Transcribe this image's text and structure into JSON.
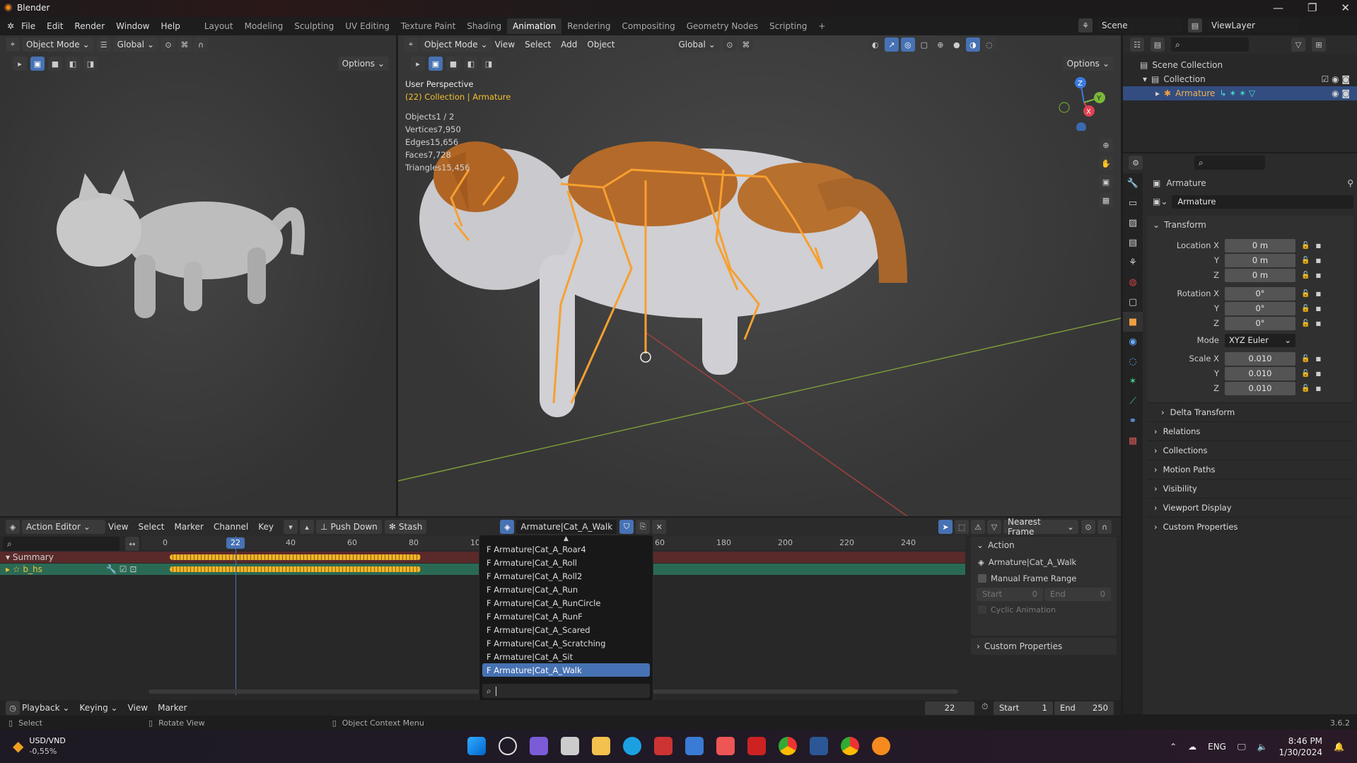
{
  "app": {
    "title": "Blender",
    "version": "3.6.2"
  },
  "menu": [
    "File",
    "Edit",
    "Render",
    "Window",
    "Help"
  ],
  "workspaces": [
    "Layout",
    "Modeling",
    "Sculpting",
    "UV Editing",
    "Texture Paint",
    "Shading",
    "Animation",
    "Rendering",
    "Compositing",
    "Geometry Nodes",
    "Scripting",
    "+"
  ],
  "active_workspace": "Animation",
  "scene": {
    "name": "Scene",
    "view_layer": "ViewLayer"
  },
  "left_view": {
    "mode": "Object Mode",
    "orientation": "Global",
    "options": "Options"
  },
  "main_view": {
    "mode": "Object Mode",
    "menus": [
      "View",
      "Select",
      "Add",
      "Object"
    ],
    "orientation": "Global",
    "options": "Options",
    "perspective": "User Perspective",
    "context": "(22) Collection | Armature",
    "stats": [
      {
        "k": "Objects",
        "v": "1 / 2"
      },
      {
        "k": "Vertices",
        "v": "7,950"
      },
      {
        "k": "Edges",
        "v": "15,656"
      },
      {
        "k": "Faces",
        "v": "7,728"
      },
      {
        "k": "Triangles",
        "v": "15,456"
      }
    ]
  },
  "outliner": {
    "scene_collection": "Scene Collection",
    "collection": "Collection",
    "armature": "Armature"
  },
  "properties": {
    "object_name": "Armature",
    "datablock": "Armature",
    "transform": "Transform",
    "location_label": "Location X",
    "rotation_label": "Rotation X",
    "scale_label": "Scale X",
    "y": "Y",
    "z": "Z",
    "mode_label": "Mode",
    "location": [
      "0 m",
      "0 m",
      "0 m"
    ],
    "rotation": [
      "0°",
      "0°",
      "0°"
    ],
    "mode": "XYZ Euler",
    "scale": [
      "0.010",
      "0.010",
      "0.010"
    ],
    "sections": [
      "Delta Transform",
      "Relations",
      "Collections",
      "Motion Paths",
      "Visibility",
      "Viewport Display",
      "Custom Properties"
    ]
  },
  "action_editor": {
    "mode": "Action Editor",
    "menus": [
      "View",
      "Select",
      "Marker",
      "Channel",
      "Key"
    ],
    "push_down": "Push Down",
    "stash": "Stash",
    "action": "Armature|Cat_A_Walk",
    "snap": "Nearest Frame",
    "ruler": [
      "0",
      "22",
      "40",
      "60",
      "80",
      "10",
      "60",
      "180",
      "200",
      "220",
      "240"
    ],
    "channels": [
      "Summary",
      "b_hs"
    ],
    "sidebar": {
      "title": "Action",
      "action": "Armature|Cat_A_Walk",
      "manual_range": "Manual Frame Range",
      "start_label": "Start",
      "start": "0",
      "end_label": "End",
      "end": "0",
      "cyclic": "Cyclic Animation",
      "custom": "Custom Properties"
    }
  },
  "action_dropdown": [
    "F Armature|Cat_A_Roar4",
    "F Armature|Cat_A_Roll",
    "F Armature|Cat_A_Roll2",
    "F Armature|Cat_A_Run",
    "F Armature|Cat_A_RunCircle",
    "F Armature|Cat_A_RunF",
    "F Armature|Cat_A_Scared",
    "F Armature|Cat_A_Scratching",
    "F Armature|Cat_A_Sit",
    "F Armature|Cat_A_Walk"
  ],
  "timeline": {
    "menus": [
      "Playback",
      "Keying",
      "View",
      "Marker"
    ],
    "current": "22",
    "start_label": "Start",
    "start": "1",
    "end_label": "End",
    "end": "250"
  },
  "statusbar": {
    "select": "Select",
    "rotate": "Rotate View",
    "context": "Object Context Menu"
  },
  "taskbar": {
    "stock": "USD/VND",
    "stock_change": "-0,55%",
    "lang": "ENG",
    "time": "8:46 PM",
    "date": "1/30/2024"
  },
  "colors": {
    "accent": "#4772b3",
    "bone": "#f7a030",
    "keyframe": "#f0b429",
    "summary": "#5a2a2a",
    "channel": "#2a6a55"
  }
}
